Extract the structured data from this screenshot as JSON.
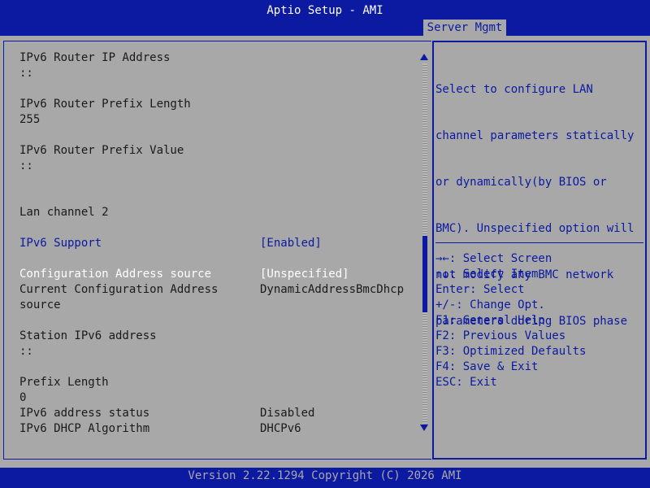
{
  "header": {
    "title": "Aptio Setup - AMI",
    "active_tab": "Server Mgmt"
  },
  "main": {
    "rows": [
      {
        "label": "IPv6 Router IP Address"
      },
      {
        "label": "::"
      },
      {
        "label": "IPv6 Router Prefix Length"
      },
      {
        "label": "255"
      },
      {
        "label": "IPv6 Router Prefix Value"
      },
      {
        "label": "::"
      },
      {
        "label": "Lan channel 2"
      },
      {
        "label": "IPv6 Support",
        "value": "[Enabled]"
      },
      {
        "label": "Configuration Address source",
        "value": "[Unspecified]"
      },
      {
        "label": "Current Configuration Address",
        "value": "DynamicAddressBmcDhcp"
      },
      {
        "label": "source"
      },
      {
        "label": "Station IPv6 address"
      },
      {
        "label": "::"
      },
      {
        "label": "Prefix Length"
      },
      {
        "label": "0"
      },
      {
        "label": "IPv6 address status",
        "value": "Disabled"
      },
      {
        "label": "IPv6 DHCP Algorithm",
        "value": "DHCPv6"
      }
    ]
  },
  "help": {
    "description_lines": [
      "Select to configure LAN",
      "channel parameters statically",
      "or dynamically(by BIOS or",
      "BMC). Unspecified option will",
      "not modify any BMC network",
      "parameters during BIOS phase"
    ],
    "keys": [
      "→←: Select Screen",
      "↑↓: Select Item",
      "Enter: Select",
      "+/-: Change Opt.",
      "F1: General Help",
      "F2: Previous Values",
      "F3: Optimized Defaults",
      "F4: Save & Exit",
      "ESC: Exit"
    ]
  },
  "footer": {
    "text": "Version 2.22.1294 Copyright (C) 2026 AMI"
  },
  "colors": {
    "bios_blue": "#0b1aa0",
    "bios_gray": "#a8a8a8",
    "text_dark": "#1a1a1a",
    "selected_white": "#ffffff"
  }
}
